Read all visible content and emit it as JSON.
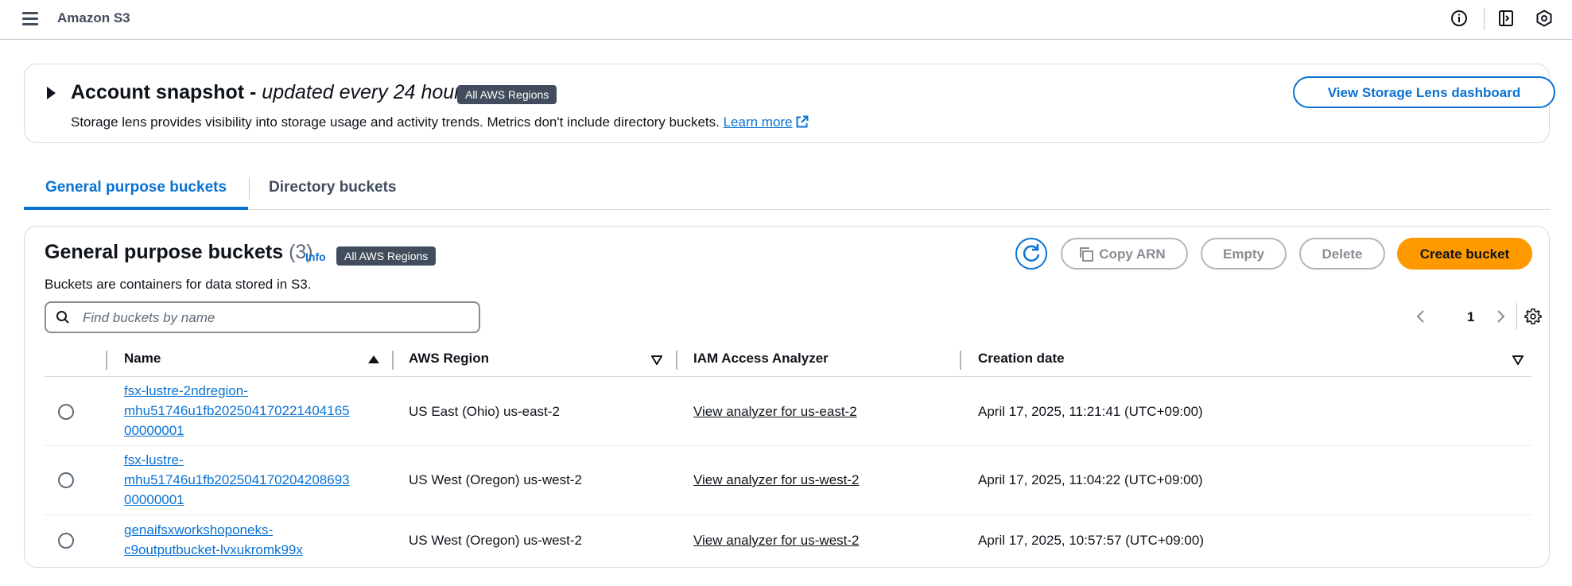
{
  "topbar": {
    "menu_icon": "hamburger-menu-icon",
    "title": "Amazon S3",
    "icons": [
      "info-icon",
      "notifications-panel-icon",
      "settings-hex-icon"
    ]
  },
  "snapshot": {
    "title_main": "Account snapshot - ",
    "title_italic": "updated every 24 hours",
    "badge": "All AWS Regions",
    "description": "Storage lens provides visibility into storage usage and activity trends. Metrics don't include directory buckets. ",
    "learn_more": "Learn more",
    "dashboard_button": "View Storage Lens dashboard"
  },
  "tabs": [
    {
      "label": "General purpose buckets",
      "active": true
    },
    {
      "label": "Directory buckets",
      "active": false
    }
  ],
  "panel": {
    "title": "General purpose buckets",
    "count": "(3)",
    "info": "Info",
    "badge": "All AWS Regions",
    "description": "Buckets are containers for data stored in S3.",
    "buttons": {
      "copy_arn": "Copy ARN",
      "empty": "Empty",
      "delete": "Delete",
      "create": "Create bucket"
    },
    "search_placeholder": "Find buckets by name",
    "page": "1"
  },
  "table": {
    "columns": [
      "Name",
      "AWS Region",
      "IAM Access Analyzer",
      "Creation date"
    ],
    "rows": [
      {
        "name": "fsx-lustre-2ndregion-mhu51746u1fb2025041702214041 6500000001",
        "name_lines": [
          "fsx-lustre-2ndregion-",
          "mhu51746u1fb202504170221404165",
          "00000001"
        ],
        "region": "US East (Ohio) us-east-2",
        "analyzer": "View analyzer for us-east-2",
        "created": "April 17, 2025, 11:21:41 (UTC+09:00)"
      },
      {
        "name_lines": [
          "fsx-lustre-",
          "mhu51746u1fb202504170204208693",
          "00000001"
        ],
        "region": "US West (Oregon) us-west-2",
        "analyzer": "View analyzer for us-west-2",
        "created": "April 17, 2025, 11:04:22 (UTC+09:00)"
      },
      {
        "name_lines": [
          "genaifsxworkshoponeks-",
          "c9outputbucket-lvxukromk99x"
        ],
        "region": "US West (Oregon) us-west-2",
        "analyzer": "View analyzer for us-west-2",
        "created": "April 17, 2025, 10:57:57 (UTC+09:00)"
      }
    ]
  },
  "colors": {
    "accent": "#0972d3",
    "primary_button": "#ff9900",
    "badge_bg": "#414d5c"
  }
}
